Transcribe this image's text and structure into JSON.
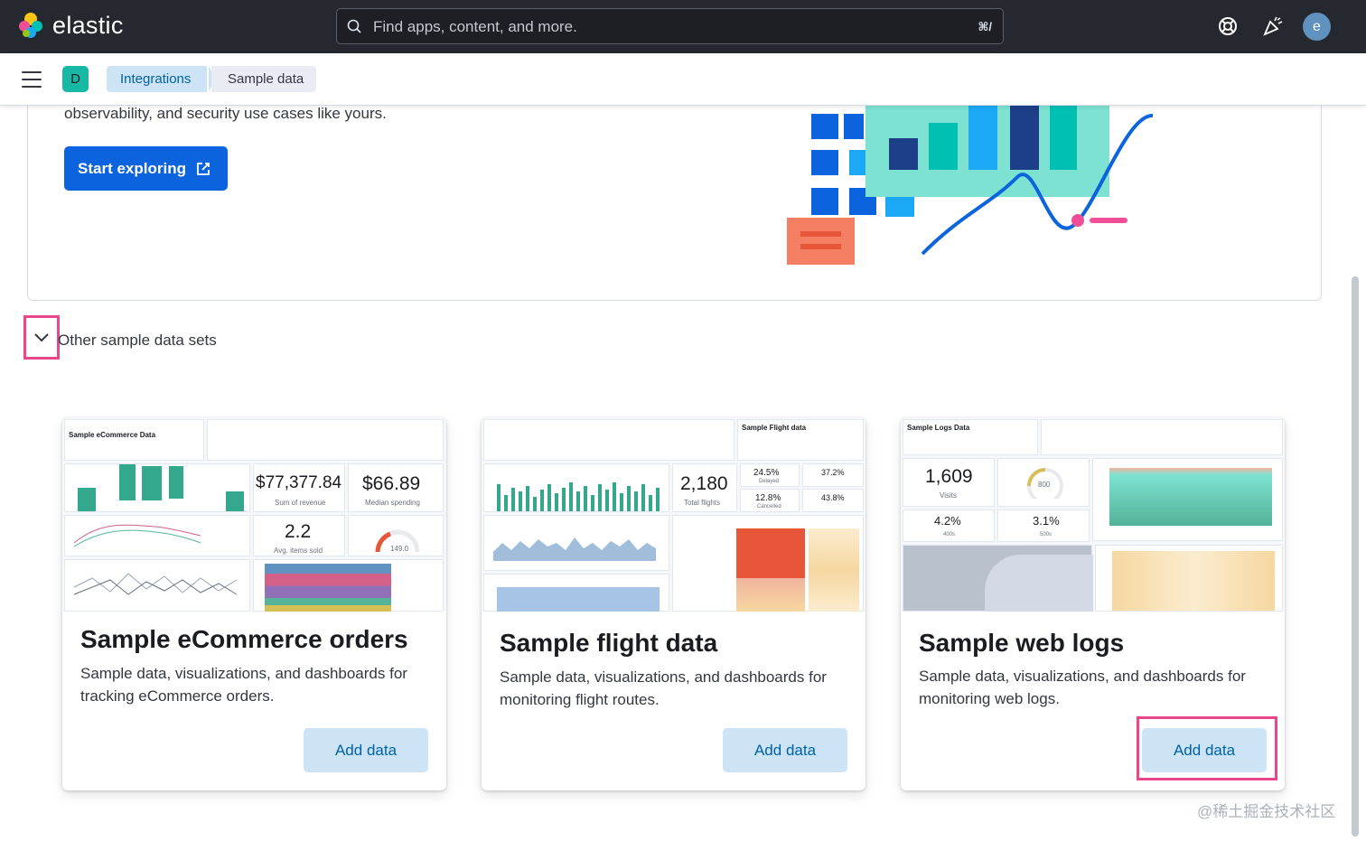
{
  "header": {
    "brand": "elastic",
    "search_placeholder": "Find apps, content, and more.",
    "search_shortcut": "⌘/",
    "avatar_initial": "e",
    "icons": [
      "search-icon",
      "help-icon",
      "news-icon"
    ]
  },
  "navbar": {
    "space_initial": "D",
    "breadcrumbs": [
      "Integrations",
      "Sample data"
    ]
  },
  "hero": {
    "text": "observability, and security use cases like yours.",
    "button_label": "Start exploring"
  },
  "accordion": {
    "label": "Other sample data sets"
  },
  "cards": [
    {
      "title": "Sample eCommerce orders",
      "description": "Sample data, visualizations, and dashboards for tracking eCommerce orders.",
      "button": "Add data",
      "thumb": {
        "heading": "Sample eCommerce Data",
        "m1": "$77,377.84",
        "m1_cap": "Sum of revenue",
        "m2": "$66.89",
        "m2_cap": "Median spending",
        "m3": "2.2",
        "m3_cap": "Avg. items sold",
        "gauge_value": "149.0"
      }
    },
    {
      "title": "Sample flight data",
      "description": "Sample data, visualizations, and dashboards for monitoring flight routes.",
      "button": "Add data",
      "thumb": {
        "heading": "Sample Flight data",
        "m1": "2,180",
        "m1_cap": "Total flights",
        "p1": "24.5%",
        "p1_cap": "Delayed",
        "p2": "37.2%",
        "p3": "12.8%",
        "p3_cap": "Cancelled",
        "p4": "43.8%"
      }
    },
    {
      "title": "Sample web logs",
      "description": "Sample data, visualizations, and dashboards for monitoring web logs.",
      "button": "Add data",
      "thumb": {
        "heading": "Sample Logs Data",
        "m1": "1,609",
        "m1_cap": "Visits",
        "gauge_value": "800",
        "m2": "4.2%",
        "m2_cap": "400s",
        "m3": "3.1%",
        "m3_cap": "500s"
      }
    }
  ],
  "watermark": "@稀土掘金技术社区",
  "colors": {
    "header_bg": "#25282f",
    "primary": "#0b64dd",
    "highlight": "#e8478b",
    "breadcrumb_active": "#cce4f5"
  }
}
